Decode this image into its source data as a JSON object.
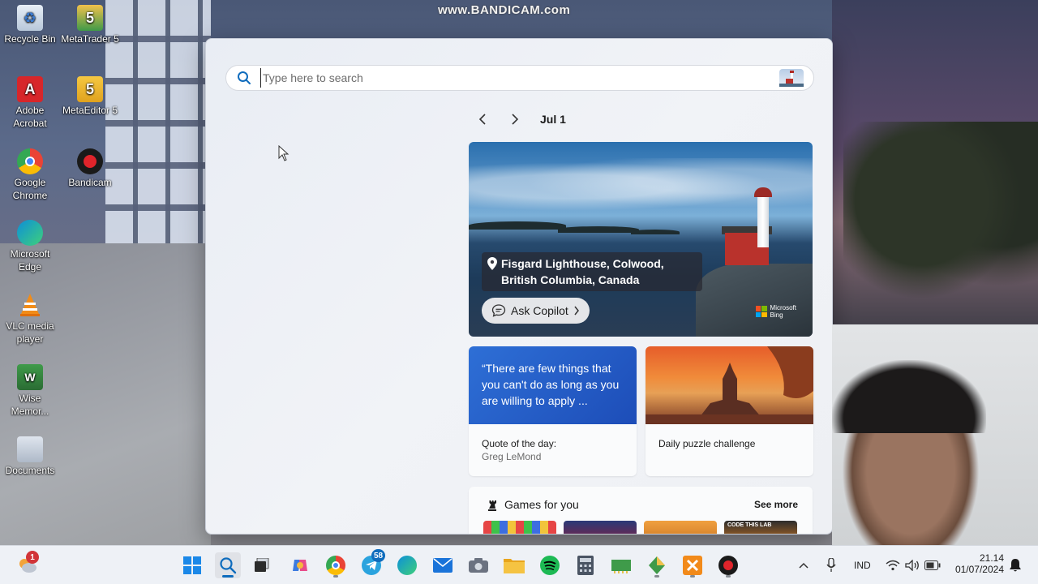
{
  "watermark": "www.BANDICAM.com",
  "desktop": {
    "icons": [
      {
        "label": "Recycle Bin"
      },
      {
        "label": "MetaTrader 5"
      },
      {
        "label": "Adobe Acrobat"
      },
      {
        "label": "MetaEditor 5"
      },
      {
        "label": "Google Chrome"
      },
      {
        "label": "Bandicam"
      },
      {
        "label": "Microsoft Edge"
      },
      {
        "label": "VLC media player"
      },
      {
        "label": "Wise Memor..."
      },
      {
        "label": "Documents"
      }
    ]
  },
  "search": {
    "placeholder": "Type here to search",
    "value": ""
  },
  "date_nav": {
    "date": "Jul 1"
  },
  "hero": {
    "location_line1": "Fisgard Lighthouse, Colwood,",
    "location_line2": "British Columbia, Canada",
    "copilot_label": "Ask Copilot",
    "brand_line1": "Microsoft",
    "brand_line2": "Bing"
  },
  "quote_card": {
    "quote": "“There are few things that you can't do as long as you are willing to apply ...",
    "label": "Quote of the day:",
    "author": "Greg LeMond"
  },
  "puzzle_card": {
    "label": "Daily puzzle challenge"
  },
  "games": {
    "title": "Games for you",
    "see_more": "See more",
    "thumb4_text": "CODE THIS LAB"
  },
  "taskbar": {
    "weather_badge": "1",
    "telegram_badge": "58",
    "language": "IND",
    "time": "21.14",
    "date": "01/07/2024"
  },
  "colors": {
    "accent": "#0f6cbd",
    "quote_bg": "#2e6fd6",
    "badge_red": "#d13438"
  }
}
